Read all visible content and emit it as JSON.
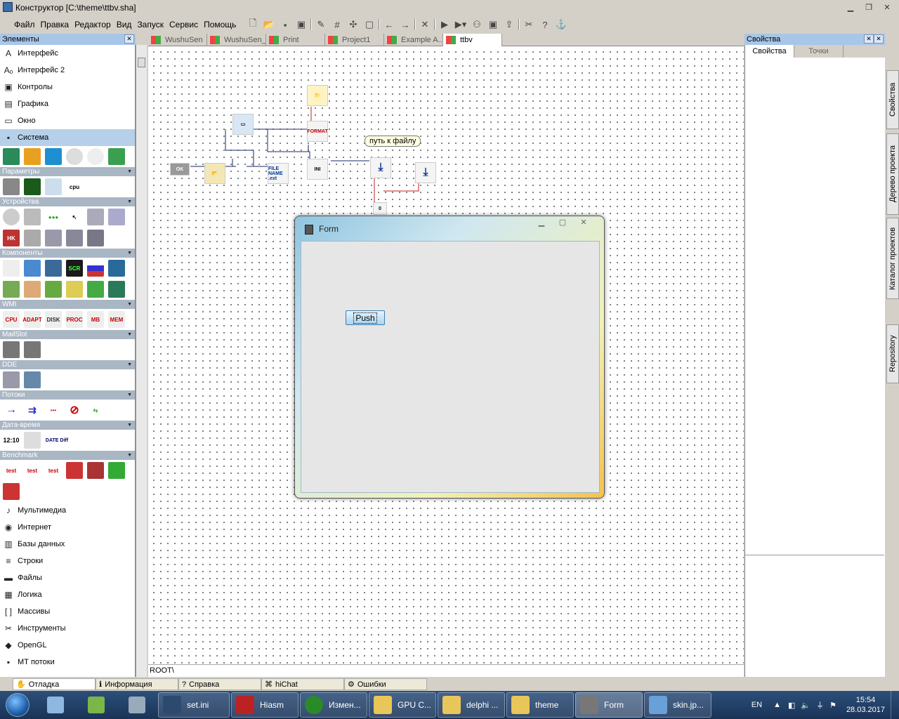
{
  "window": {
    "title": "Конструктор [C:\\theme\\ttbv.sha]"
  },
  "menu": [
    "Файл",
    "Правка",
    "Редактор",
    "Вид",
    "Запуск",
    "Сервис",
    "Помощь"
  ],
  "left_panel": {
    "title": "Элементы",
    "categories_top": [
      {
        "label": "Интерфейс",
        "icon": "A"
      },
      {
        "label": "Интерфейс 2",
        "icon": "Aₒ"
      },
      {
        "label": "Контролы",
        "icon": "▣"
      },
      {
        "label": "Графика",
        "icon": "▤"
      },
      {
        "label": "Окно",
        "icon": "▭"
      },
      {
        "label": "Система",
        "icon": "▪"
      }
    ],
    "groups": [
      {
        "label": "Параметры"
      },
      {
        "label": "Устройства"
      },
      {
        "label": "Компоненты"
      },
      {
        "label": "WMI"
      },
      {
        "label": "MailSlot"
      },
      {
        "label": "DDE"
      },
      {
        "label": "Потоки"
      },
      {
        "label": "Дата-время"
      },
      {
        "label": "Benchmark"
      }
    ],
    "wmi_icons": [
      "CPU",
      "ADAPT",
      "DISK",
      "PROC",
      "MB",
      "MEM"
    ],
    "date_labels": [
      "12:10",
      "DATE Diff"
    ],
    "benchmark_labels": [
      "test",
      "test",
      "test"
    ],
    "param_label": "cpu",
    "categories_bottom": [
      {
        "label": "Мультимедиа",
        "icon": "♪"
      },
      {
        "label": "Интернет",
        "icon": "◉"
      },
      {
        "label": "Базы данных",
        "icon": "▥"
      },
      {
        "label": "Строки",
        "icon": "≡"
      },
      {
        "label": "Файлы",
        "icon": "▬"
      },
      {
        "label": "Логика",
        "icon": "▦"
      },
      {
        "label": "Массивы",
        "icon": "[ ]"
      },
      {
        "label": "Инструменты",
        "icon": "✂"
      },
      {
        "label": "OpenGL",
        "icon": "◆"
      },
      {
        "label": "МТ потоки",
        "icon": "▪"
      }
    ]
  },
  "tabs": [
    "WushuSen",
    "WushuSen_v1",
    "Print",
    "Project1",
    "Example A...",
    "ttbv"
  ],
  "canvas": {
    "hint": "путь к файлу",
    "path": "ROOT\\",
    "node_labels": {
      "ok": "OK",
      "format": "FORMAT",
      "filename": "FILE NAME .ext",
      "ini": "INI"
    }
  },
  "form_window": {
    "title": "Form",
    "button": "Push"
  },
  "right_panel": {
    "title": "Свойства",
    "tabs": [
      "Свойства",
      "Точки"
    ]
  },
  "side_tabs": [
    "Свойства",
    "Дерево проекта",
    "Каталог проектов",
    "Repository"
  ],
  "bottom_tabs": [
    "Отладка",
    "Информация",
    "Справка",
    "hiChat",
    "Ошибки"
  ],
  "taskbar": {
    "items": [
      {
        "label": "set.ini",
        "color": "#2b4a6e"
      },
      {
        "label": "Hiasm",
        "color": "#b22"
      },
      {
        "label": "Измен...",
        "color": "#2a8a2a"
      },
      {
        "label": "GPU C...",
        "color": "#e8c65a"
      },
      {
        "label": "delphi ...",
        "color": "#e8c65a"
      },
      {
        "label": "theme",
        "color": "#e8c65a"
      },
      {
        "label": "Form",
        "color": "#777"
      },
      {
        "label": "skin.jp...",
        "color": "#6aa0d8"
      }
    ],
    "lang": "EN",
    "time": "15:54",
    "date": "28.03.2017"
  }
}
